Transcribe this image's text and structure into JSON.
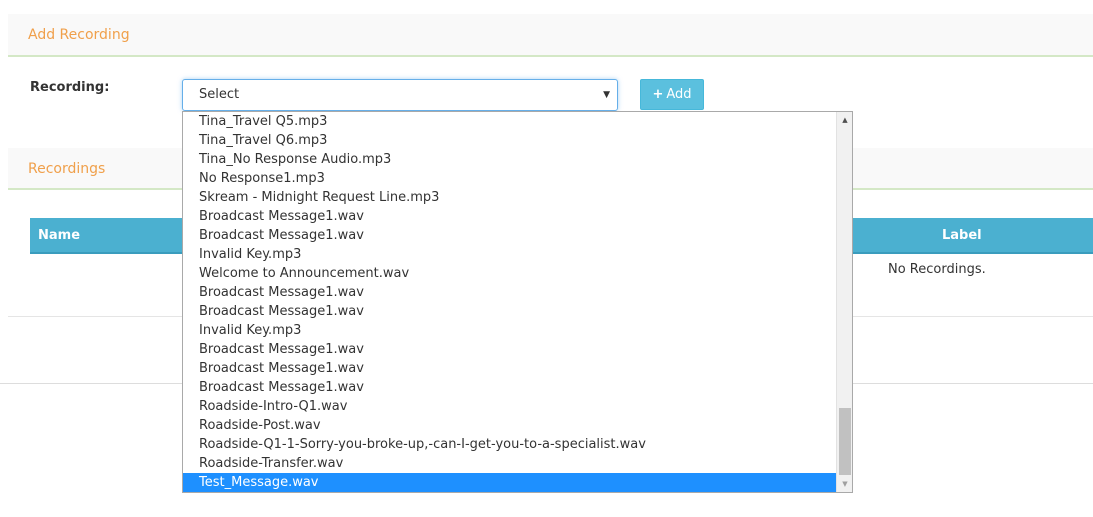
{
  "add_section": {
    "title": "Add Recording",
    "recording_label": "Recording:",
    "select_value": "Select",
    "add_button": "Add"
  },
  "recordings_section": {
    "title": "Recordings",
    "columns": [
      "Name",
      "Label"
    ],
    "empty_text": "No Recordings."
  },
  "dropdown": {
    "options": [
      "Tina_Travel Q5.mp3",
      "Tina_Travel Q6.mp3",
      "Tina_No Response Audio.mp3",
      "No Response1.mp3",
      "Skream - Midnight Request Line.mp3",
      "Broadcast Message1.wav",
      "Broadcast Message1.wav",
      "Invalid Key.mp3",
      "Welcome to Announcement.wav",
      "Broadcast Message1.wav",
      "Broadcast Message1.wav",
      "Invalid Key.mp3",
      "Broadcast Message1.wav",
      "Broadcast Message1.wav",
      "Broadcast Message1.wav",
      "Roadside-Intro-Q1.wav",
      "Roadside-Post.wav",
      "Roadside-Q1-1-Sorry-you-broke-up,-can-I-get-you-to-a-specialist.wav",
      "Roadside-Transfer.wav",
      "Test_Message.wav"
    ],
    "highlighted_option": "Test_Message.wav"
  },
  "colors": {
    "section_title": "#f0a04b",
    "table_header": "#4bb0d0",
    "add_button": "#5bc0de",
    "highlight": "#1e90ff"
  },
  "icons": {
    "select_arrow": "triangle-down-icon",
    "add": "plus-icon",
    "scroll_up": "scroll-up-arrow-icon",
    "scroll_down": "scroll-down-arrow-icon"
  }
}
